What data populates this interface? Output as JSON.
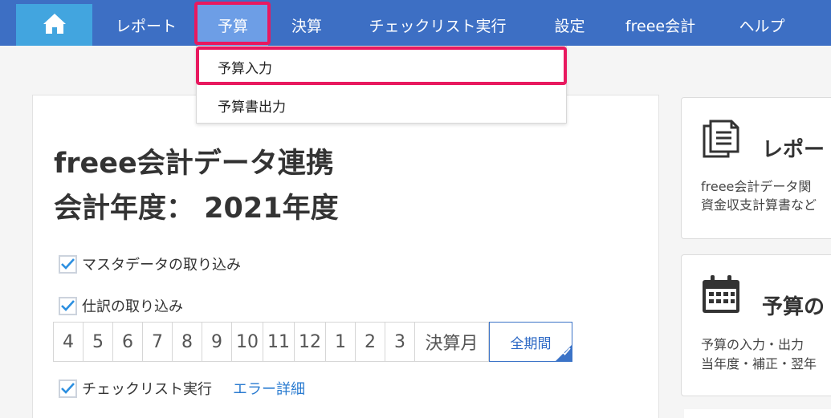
{
  "nav": {
    "home_icon": "home-icon",
    "items": [
      {
        "label": "レポート"
      },
      {
        "label": "予算"
      },
      {
        "label": "決算"
      },
      {
        "label": "チェックリスト実行"
      },
      {
        "label": "設定"
      },
      {
        "label": "freee会計"
      },
      {
        "label": "ヘルプ"
      }
    ],
    "active": "予算"
  },
  "dropdown": {
    "items": [
      {
        "label": "予算入力"
      },
      {
        "label": "予算書出力"
      }
    ],
    "highlighted": "予算入力"
  },
  "main": {
    "title_line1": "freee会計データ連携",
    "title_line2": "会計年度： 2021年度",
    "option_master": "マスタデータの取り込み",
    "option_journal": "仕訳の取り込み",
    "months": [
      "4",
      "5",
      "6",
      "7",
      "8",
      "9",
      "10",
      "11",
      "12",
      "1",
      "2",
      "3"
    ],
    "kessan_label": "決算月",
    "all_period_label": "全期間",
    "option_checklist": "チェックリスト実行",
    "error_link": "エラー詳細"
  },
  "side": {
    "report": {
      "title": "レポー",
      "line1": "freee会計データ関",
      "line2": "資金収支計算書など",
      "icon": "document-icon"
    },
    "budget": {
      "title": "予算の",
      "line1": "予算の入力・出力",
      "line2": "当年度・補正・翌年",
      "icon": "calendar-icon"
    }
  },
  "colors": {
    "navbar": "#3d6fc4",
    "home": "#42a5df",
    "active_tab": "#6d9ee6",
    "highlight": "#e8195f",
    "link": "#2a7bd0"
  }
}
